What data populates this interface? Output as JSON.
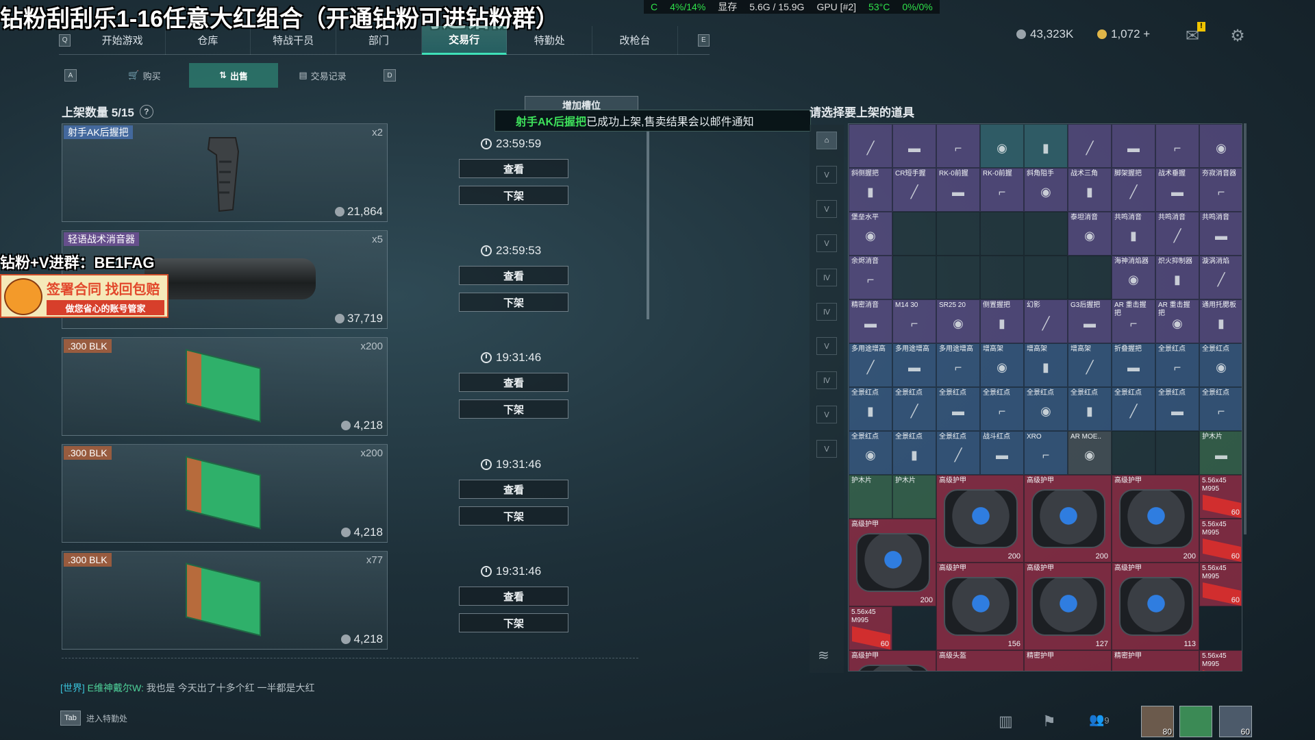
{
  "overlay": {
    "stream_title": "钻粉刮刮乐1-16任意大红组合（开通钻粉可进钻粉群）",
    "ad_line": "钻粉+V进群：BE1FAG",
    "ad_title": "签署合同 找回包赔",
    "ad_sub": "做您省心的账号管家"
  },
  "sysbar": {
    "cpu_tail": "C",
    "usage": "4%/14%",
    "vram_label": "显存",
    "vram": "5.6G / 15.9G",
    "gpu": "GPU [#2]",
    "temp": "53°C",
    "gpu_usage": "0%/0%"
  },
  "nav": {
    "key_left": "Q",
    "key_right": "E",
    "tabs": [
      "开始游戏",
      "仓库",
      "特战干员",
      "部门",
      "交易行",
      "特勤处",
      "改枪台"
    ],
    "active": "交易行"
  },
  "currency": {
    "silver": "43,323K",
    "gold": "1,072 +"
  },
  "subnav": {
    "key_left": "A",
    "key_right": "D",
    "tabs": [
      "购买",
      "出售",
      "交易记录"
    ],
    "active": "出售"
  },
  "listings": {
    "header": "上架数量 5/15",
    "help": "?",
    "add_slot": "增加槽位",
    "view_label": "查看",
    "delist_label": "下架",
    "items": [
      {
        "name": "射手AK后握把",
        "qty": "x2",
        "price": "21,864",
        "timer": "23:59:59",
        "rarity": "blue"
      },
      {
        "name": "轻语战术消音器",
        "qty": "x5",
        "price": "37,719",
        "timer": "23:59:53",
        "rarity": "purple"
      },
      {
        "name": ".300 BLK",
        "qty": "x200",
        "price": "4,218",
        "timer": "19:31:46",
        "rarity": "orange"
      },
      {
        "name": ".300 BLK",
        "qty": "x200",
        "price": "4,218",
        "timer": "19:31:46",
        "rarity": "orange"
      },
      {
        "name": ".300 BLK",
        "qty": "x77",
        "price": "4,218",
        "timer": "19:31:46",
        "rarity": "orange"
      }
    ]
  },
  "toast": {
    "item": "射手AK后握把",
    "message": "已成功上架,售卖结果会以邮件通知"
  },
  "inventory": {
    "header": "请选择要上架的道具",
    "categories": [
      "全部",
      "Ⅴ",
      "Ⅴ",
      "Ⅴ",
      "Ⅳ",
      "Ⅳ",
      "Ⅴ",
      "Ⅳ",
      "Ⅴ",
      "Ⅴ"
    ],
    "cells": [
      {
        "label": "",
        "color": "purple"
      },
      {
        "label": "",
        "color": "purple"
      },
      {
        "label": "",
        "color": "purple"
      },
      {
        "label": "",
        "color": "teal"
      },
      {
        "label": "",
        "color": "teal"
      },
      {
        "label": "",
        "color": "purple"
      },
      {
        "label": "",
        "color": "purple"
      },
      {
        "label": "",
        "color": "purple"
      },
      {
        "label": "",
        "color": "purple"
      },
      {
        "label": "斜侧握把",
        "color": "purple"
      },
      {
        "label": "CR短手握",
        "color": "purple"
      },
      {
        "label": "RK-0前握",
        "color": "purple"
      },
      {
        "label": "RK-0前握",
        "color": "purple"
      },
      {
        "label": "斜角阻手",
        "color": "purple"
      },
      {
        "label": "战术三角",
        "color": "purple"
      },
      {
        "label": "脚架握把",
        "color": "purple"
      },
      {
        "label": "战术垂握",
        "color": "purple"
      },
      {
        "label": "夯寂消音器",
        "color": "purple"
      },
      {
        "label": "堡垒水平",
        "color": "purple"
      },
      {
        "label": "",
        "color": "empty"
      },
      {
        "label": "",
        "color": "empty"
      },
      {
        "label": "",
        "color": "empty"
      },
      {
        "label": "",
        "color": "empty"
      },
      {
        "label": "泰坦消音",
        "color": "purple"
      },
      {
        "label": "共鸣消音",
        "color": "purple"
      },
      {
        "label": "共鸣消音",
        "color": "purple"
      },
      {
        "label": "共鸣消音",
        "color": "purple"
      },
      {
        "label": "余烬消音",
        "color": "purple"
      },
      {
        "label": "",
        "color": "empty"
      },
      {
        "label": "",
        "color": "empty"
      },
      {
        "label": "",
        "color": "empty"
      },
      {
        "label": "",
        "color": "empty"
      },
      {
        "label": "",
        "color": "empty"
      },
      {
        "label": "海神消焰器",
        "color": "purple"
      },
      {
        "label": "炽火抑制器",
        "color": "purple"
      },
      {
        "label": "漩涡消焰",
        "color": "purple"
      },
      {
        "label": "精密消音",
        "color": "purple"
      },
      {
        "label": "M14 30",
        "color": "purple"
      },
      {
        "label": "SR25 20",
        "color": "purple"
      },
      {
        "label": "侧置握把",
        "color": "purple"
      },
      {
        "label": "幻影",
        "color": "purple"
      },
      {
        "label": "G3后握把",
        "color": "purple"
      },
      {
        "label": "AR 重击握把",
        "color": "purple"
      },
      {
        "label": "AR 重击握把",
        "color": "purple"
      },
      {
        "label": "通用托腮板",
        "color": "purple"
      },
      {
        "label": "多用途增高",
        "color": "blue"
      },
      {
        "label": "多用途增高",
        "color": "blue"
      },
      {
        "label": "多用途增高",
        "color": "blue"
      },
      {
        "label": "增高架",
        "color": "blue"
      },
      {
        "label": "增高架",
        "color": "blue"
      },
      {
        "label": "增高架",
        "color": "blue"
      },
      {
        "label": "折叠握把",
        "color": "blue"
      },
      {
        "label": "全景红点",
        "color": "blue"
      },
      {
        "label": "全景红点",
        "color": "blue"
      },
      {
        "label": "全景红点",
        "color": "blue"
      },
      {
        "label": "全景红点",
        "color": "blue"
      },
      {
        "label": "全景红点",
        "color": "blue"
      },
      {
        "label": "全景红点",
        "color": "blue"
      },
      {
        "label": "全景红点",
        "color": "blue"
      },
      {
        "label": "全景红点",
        "color": "blue"
      },
      {
        "label": "全景红点",
        "color": "blue"
      },
      {
        "label": "全景红点",
        "color": "blue"
      },
      {
        "label": "全景红点",
        "color": "blue"
      },
      {
        "label": "全景红点",
        "color": "blue"
      },
      {
        "label": "全景红点",
        "color": "blue"
      },
      {
        "label": "全景红点",
        "color": "blue"
      },
      {
        "label": "战斗红点",
        "color": "blue"
      },
      {
        "label": "XRO",
        "color": "blue"
      },
      {
        "label": "AR MOE..",
        "color": "gray"
      },
      {
        "label": "",
        "color": "empty"
      },
      {
        "label": "",
        "color": "empty"
      },
      {
        "label": "护木片",
        "color": "green"
      }
    ],
    "armor": [
      {
        "label": "高级护甲",
        "count": "200"
      },
      {
        "label": "高级护甲",
        "count": "200"
      },
      {
        "label": "高级护甲",
        "count": "200"
      },
      {
        "label": "高级护甲",
        "count": "200"
      },
      {
        "label": "高级护甲",
        "count": "156"
      },
      {
        "label": "高级护甲",
        "count": "127"
      },
      {
        "label": "高级护甲",
        "count": "113"
      },
      {
        "label": "高级护甲",
        "count": ""
      }
    ],
    "small_row": [
      {
        "label": "护木片"
      },
      {
        "label": "护木片"
      }
    ],
    "ammo": [
      {
        "label": "5.56x45 M995",
        "count": "60"
      },
      {
        "label": "5.56x45 M995",
        "count": "60"
      },
      {
        "label": "5.56x45 M995",
        "count": "60"
      },
      {
        "label": "5.56x45 M995",
        "count": "60"
      },
      {
        "label": "5.56x45 M995",
        "count": ""
      }
    ],
    "bottom_labels": [
      "高级头盔",
      "精密护甲",
      "精密护甲"
    ]
  },
  "chat": {
    "channel": "[世界]",
    "sender": "E维神戴尔W:",
    "text": "我也是 今天出了十多个红 一半都是大红"
  },
  "footer": {
    "tab_key": "Tab",
    "tab_hint": "进入特勤处",
    "friends_count": "9",
    "avatar_levels": [
      "80",
      "",
      "60"
    ]
  }
}
